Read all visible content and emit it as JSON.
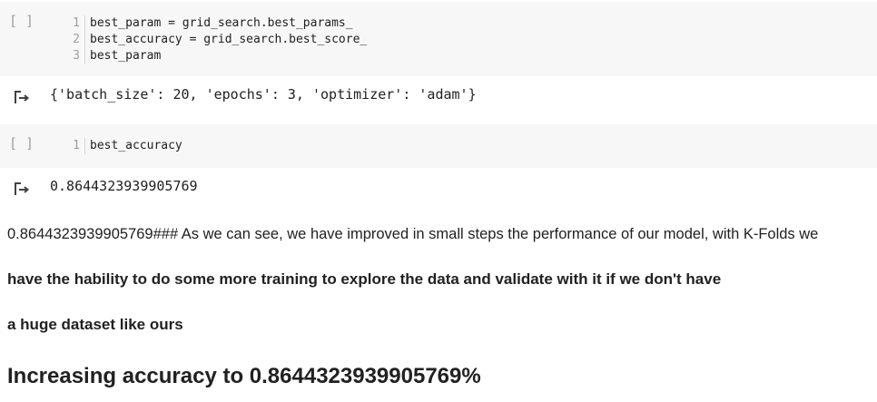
{
  "cells": [
    {
      "run_button": "[ ]",
      "lines": [
        {
          "num": "1",
          "code": "best_param = grid_search.best_params_"
        },
        {
          "num": "2",
          "code": "best_accuracy = grid_search.best_score_"
        },
        {
          "num": "3",
          "code": "best_param"
        }
      ],
      "output": "{'batch_size': 20, 'epochs': 3, 'optimizer': 'adam'}"
    },
    {
      "run_button": "[ ]",
      "lines": [
        {
          "num": "1",
          "code": "best_accuracy"
        }
      ],
      "output": "0.8644323939905769"
    }
  ],
  "markdown": {
    "line1": "0.8644323939905769### As we can see, we have improved in small steps the performance of our model, with K-Folds we",
    "line2": "have the hability to do some more training to explore the data and validate with it if we don't have",
    "line3": "a huge dataset like ours",
    "heading": "Increasing accuracy to 0.8644323939905769%"
  },
  "icons": {
    "output_icon": "output-arrow-icon"
  }
}
